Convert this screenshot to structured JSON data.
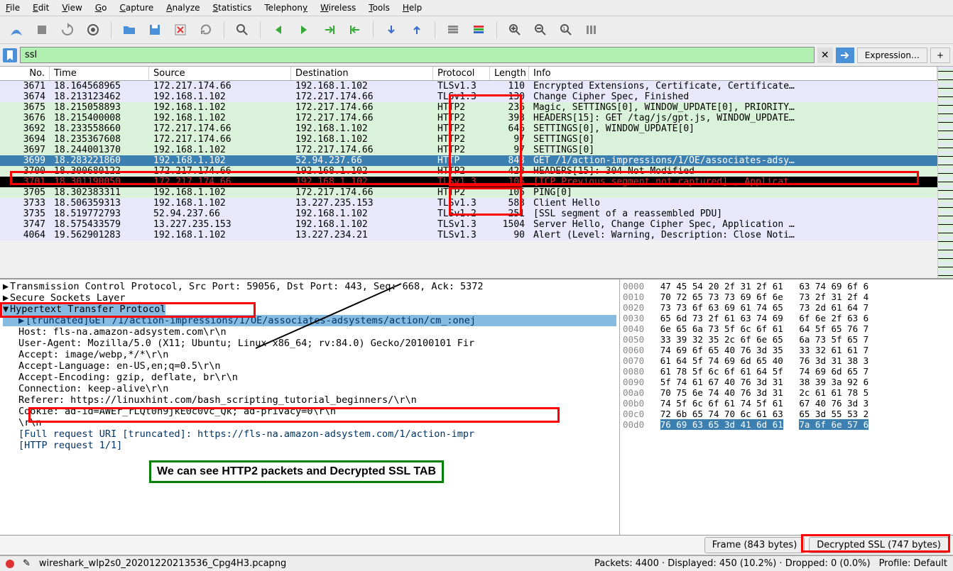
{
  "menu": [
    "File",
    "Edit",
    "View",
    "Go",
    "Capture",
    "Analyze",
    "Statistics",
    "Telephony",
    "Wireless",
    "Tools",
    "Help"
  ],
  "toolbar_icons": [
    "shark-fin",
    "stop",
    "restart",
    "gear",
    "sep",
    "folder-open",
    "save",
    "close-file",
    "reload",
    "sep",
    "search",
    "sep",
    "arrow-left-green",
    "arrow-right-green",
    "arrow-jump",
    "arrow-end",
    "sep",
    "arrow-down-blue",
    "arrow-up-blue",
    "sep",
    "lines",
    "lines-color",
    "sep",
    "zoom-in",
    "zoom-out",
    "zoom-reset",
    "resize-cols"
  ],
  "filter": {
    "value": "ssl",
    "expression_btn": "Expression…"
  },
  "columns": [
    "No.",
    "Time",
    "Source",
    "Destination",
    "Protocol",
    "Length",
    "Info"
  ],
  "packets": [
    {
      "no": "3671",
      "time": "18.164568965",
      "src": "172.217.174.66",
      "dst": "192.168.1.102",
      "proto": "TLSv1.3",
      "len": "110",
      "info": "Encrypted Extensions, Certificate, Certificate…",
      "bg": "lavender"
    },
    {
      "no": "3674",
      "time": "18.213123462",
      "src": "192.168.1.102",
      "dst": "172.217.174.66",
      "proto": "TLSv1.3",
      "len": "130",
      "info": "Change Cipher Spec, Finished",
      "bg": "lavender"
    },
    {
      "no": "3675",
      "time": "18.215058893",
      "src": "192.168.1.102",
      "dst": "172.217.174.66",
      "proto": "HTTP2",
      "len": "236",
      "info": "Magic, SETTINGS[0], WINDOW_UPDATE[0], PRIORITY…",
      "bg": "green"
    },
    {
      "no": "3676",
      "time": "18.215400008",
      "src": "192.168.1.102",
      "dst": "172.217.174.66",
      "proto": "HTTP2",
      "len": "393",
      "info": "HEADERS[15]: GET /tag/js/gpt.js, WINDOW_UPDATE…",
      "bg": "green"
    },
    {
      "no": "3692",
      "time": "18.233558660",
      "src": "172.217.174.66",
      "dst": "192.168.1.102",
      "proto": "HTTP2",
      "len": "646",
      "info": "SETTINGS[0], WINDOW_UPDATE[0]",
      "bg": "green"
    },
    {
      "no": "3694",
      "time": "18.235367608",
      "src": "172.217.174.66",
      "dst": "192.168.1.102",
      "proto": "HTTP2",
      "len": "97",
      "info": "SETTINGS[0]",
      "bg": "green"
    },
    {
      "no": "3697",
      "time": "18.244001370",
      "src": "192.168.1.102",
      "dst": "172.217.174.66",
      "proto": "HTTP2",
      "len": "97",
      "info": "SETTINGS[0]",
      "bg": "green"
    },
    {
      "no": "3699",
      "time": "18.283221860",
      "src": "192.168.1.102",
      "dst": "52.94.237.66",
      "proto": "HTTP",
      "len": "843",
      "info": "GET /1/action-impressions/1/OE/associates-adsy…",
      "bg": "sel"
    },
    {
      "no": "3700",
      "time": "18.300680122",
      "src": "172.217.174.66",
      "dst": "192.168.1.102",
      "proto": "HTTP2",
      "len": "423",
      "info": "HEADERS[15]: 304 Not Modified",
      "bg": "green"
    },
    {
      "no": "3701",
      "time": "18.301190050",
      "src": "172.217.174.66",
      "dst": "192.168.1.102",
      "proto": "TLSv1.3",
      "len": "105",
      "info": "[TCP Previous segment not captured] , Applicat…",
      "bg": "black"
    },
    {
      "no": "3705",
      "time": "18.302383311",
      "src": "192.168.1.102",
      "dst": "172.217.174.66",
      "proto": "HTTP2",
      "len": "105",
      "info": "PING[0]",
      "bg": "green"
    },
    {
      "no": "3733",
      "time": "18.506359313",
      "src": "192.168.1.102",
      "dst": "13.227.235.153",
      "proto": "TLSv1.3",
      "len": "583",
      "info": "Client Hello",
      "bg": "lavender"
    },
    {
      "no": "3735",
      "time": "18.519772793",
      "src": "52.94.237.66",
      "dst": "192.168.1.102",
      "proto": "TLSv1.2",
      "len": "251",
      "info": "[SSL segment of a reassembled PDU]",
      "bg": "lavender"
    },
    {
      "no": "3747",
      "time": "18.575433579",
      "src": "13.227.235.153",
      "dst": "192.168.1.102",
      "proto": "TLSv1.3",
      "len": "1504",
      "info": "Server Hello, Change Cipher Spec, Application …",
      "bg": "lavender"
    },
    {
      "no": "4064",
      "time": "19.562901283",
      "src": "192.168.1.102",
      "dst": "13.227.234.21",
      "proto": "TLSv1.3",
      "len": "90",
      "info": "Alert (Level: Warning, Description: Close Noti…",
      "bg": "lavender"
    }
  ],
  "details": {
    "tcp": "Transmission Control Protocol, Src Port: 59056, Dst Port: 443, Seq: 668, Ack: 5372",
    "ssl": "Secure Sockets Layer",
    "http": "Hypertext Transfer Protocol",
    "lines": [
      "[truncated]GET /1/action-impressions/1/OE/associates-adsystems/action/cm_:onej",
      "Host: fls-na.amazon-adsystem.com\\r\\n",
      "User-Agent: Mozilla/5.0 (X11; Ubuntu; Linux x86_64; rv:84.0) Gecko/20100101 Fir",
      "Accept: image/webp,*/*\\r\\n",
      "Accept-Language: en-US,en;q=0.5\\r\\n",
      "Accept-Encoding: gzip, deflate, br\\r\\n",
      "Connection: keep-alive\\r\\n",
      "Referer: https://linuxhint.com/bash_scripting_tutorial_beginners/\\r\\n",
      "Cookie: ad-id=AWEr_rLQt0n9jkE0c0vc_Qk; ad-privacy=0\\r\\n",
      "\\r\\n",
      "[Full request URI [truncated]: https://fls-na.amazon-adsystem.com/1/action-impr",
      "[HTTP request 1/1]"
    ]
  },
  "hex": [
    {
      "off": "0000",
      "b": "47 45 54 20 2f 31 2f 61",
      "a": "63 74 69 6f 6"
    },
    {
      "off": "0010",
      "b": "70 72 65 73 73 69 6f 6e",
      "a": "73 2f 31 2f 4"
    },
    {
      "off": "0020",
      "b": "73 73 6f 63 69 61 74 65",
      "a": "73 2d 61 64 7"
    },
    {
      "off": "0030",
      "b": "65 6d 73 2f 61 63 74 69",
      "a": "6f 6e 2f 63 6"
    },
    {
      "off": "0040",
      "b": "6e 65 6a 73 5f 6c 6f 61",
      "a": "64 5f 65 76 7"
    },
    {
      "off": "0050",
      "b": "33 39 32 35 2c 6f 6e 65",
      "a": "6a 73 5f 65 7"
    },
    {
      "off": "0060",
      "b": "74 69 6f 65 40 76 3d 35",
      "a": "33 32 61 61 7"
    },
    {
      "off": "0070",
      "b": "61 64 5f 74 69 6d 65 40",
      "a": "76 3d 31 38 3"
    },
    {
      "off": "0080",
      "b": "61 78 5f 6c 6f 61 64 5f",
      "a": "74 69 6d 65 7"
    },
    {
      "off": "0090",
      "b": "5f 74 61 67 40 76 3d 31",
      "a": "38 39 3a 92 6"
    },
    {
      "off": "00a0",
      "b": "70 75 6e 74 40 76 3d 31",
      "a": "2c 61 61 78 5"
    },
    {
      "off": "00b0",
      "b": "74 5f 6c 6f 61 74 5f 61",
      "a": "67 40 76 3d 3"
    },
    {
      "off": "00c0",
      "b": "72 6b 65 74 70 6c 61 63",
      "a": "65 3d 55 53 2"
    },
    {
      "off": "00d0",
      "b": "76 69 63 65 3d 41 6d 61",
      "a": "7a 6f 6e 57 6",
      "sel": true
    }
  ],
  "tabs": {
    "frame": "Frame (843 bytes)",
    "decrypted": "Decrypted SSL (747 bytes)"
  },
  "status": {
    "file": "wireshark_wlp2s0_20201220213536_Cpg4H3.pcapng",
    "stats": "Packets: 4400 · Displayed: 450 (10.2%) · Dropped: 0 (0.0%)",
    "profile": "Profile: Default"
  },
  "annotation": "We can see HTTP2 packets and Decrypted SSL TAB"
}
